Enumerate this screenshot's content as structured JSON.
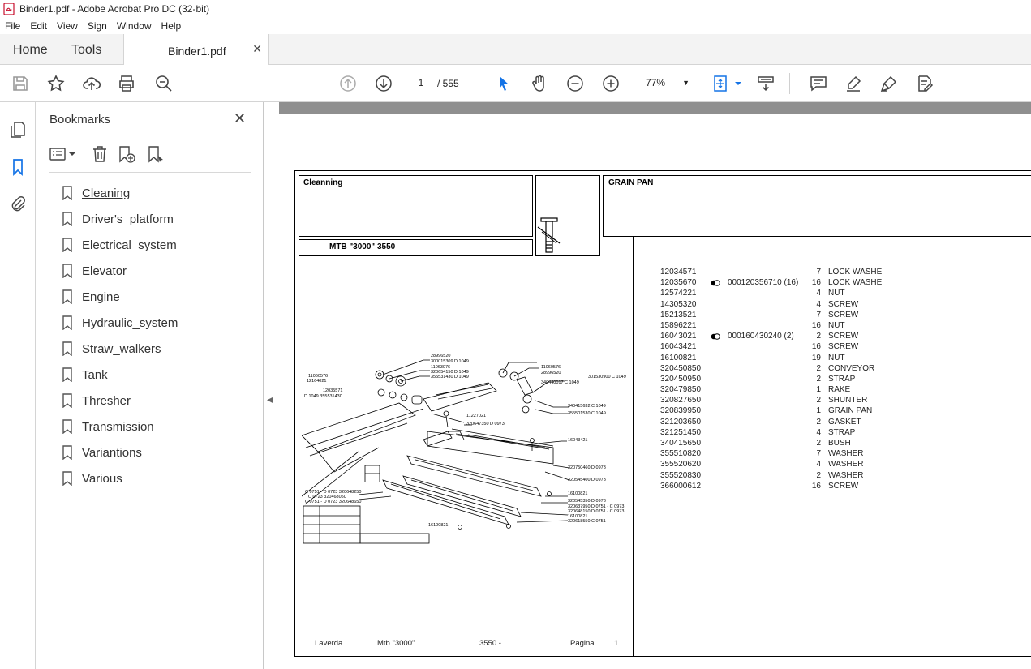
{
  "window": {
    "title": "Binder1.pdf - Adobe Acrobat Pro DC (32-bit)"
  },
  "menu": [
    "File",
    "Edit",
    "View",
    "Sign",
    "Window",
    "Help"
  ],
  "tabs": {
    "home": "Home",
    "tools": "Tools",
    "document": "Binder1.pdf"
  },
  "toolbar": {
    "page_current": "1",
    "page_total": "/ 555",
    "zoom": "77%"
  },
  "bookmarks": {
    "title": "Bookmarks",
    "items": [
      {
        "label": "Cleaning"
      },
      {
        "label": "Driver's_platform"
      },
      {
        "label": "Electrical_system"
      },
      {
        "label": "Elevator"
      },
      {
        "label": "Engine"
      },
      {
        "label": "Hydraulic_system"
      },
      {
        "label": "Straw_walkers"
      },
      {
        "label": "Tank"
      },
      {
        "label": "Thresher"
      },
      {
        "label": "Transmission"
      },
      {
        "label": "Variantions"
      },
      {
        "label": "Various"
      }
    ]
  },
  "document": {
    "group": "Cleanning",
    "model": "MTB \"3000\" 3550",
    "section": "GRAIN PAN",
    "parts": [
      {
        "code": "12034571",
        "alt": "",
        "qty": "7",
        "desc": "LOCK WASHE"
      },
      {
        "code": "12035670",
        "alt": "000120356710 (16)",
        "qty": "16",
        "desc": "LOCK WASHE"
      },
      {
        "code": "12574221",
        "alt": "",
        "qty": "4",
        "desc": "NUT"
      },
      {
        "code": "14305320",
        "alt": "",
        "qty": "4",
        "desc": "SCREW"
      },
      {
        "code": "15213521",
        "alt": "",
        "qty": "7",
        "desc": "SCREW"
      },
      {
        "code": "15896221",
        "alt": "",
        "qty": "16",
        "desc": "NUT"
      },
      {
        "code": "16043021",
        "alt": "000160430240 (2)",
        "qty": "2",
        "desc": "SCREW"
      },
      {
        "code": "16043421",
        "alt": "",
        "qty": "16",
        "desc": "SCREW"
      },
      {
        "code": "16100821",
        "alt": "",
        "qty": "19",
        "desc": "NUT"
      },
      {
        "code": "320450850",
        "alt": "",
        "qty": "2",
        "desc": "CONVEYOR"
      },
      {
        "code": "320450950",
        "alt": "",
        "qty": "2",
        "desc": "STRAP"
      },
      {
        "code": "320479850",
        "alt": "",
        "qty": "1",
        "desc": "RAKE"
      },
      {
        "code": "320827650",
        "alt": "",
        "qty": "2",
        "desc": "SHUNTER"
      },
      {
        "code": "320839950",
        "alt": "",
        "qty": "1",
        "desc": "GRAIN PAN"
      },
      {
        "code": "321203650",
        "alt": "",
        "qty": "2",
        "desc": "GASKET"
      },
      {
        "code": "321251450",
        "alt": "",
        "qty": "4",
        "desc": "STRAP"
      },
      {
        "code": "340415650",
        "alt": "",
        "qty": "2",
        "desc": "BUSH"
      },
      {
        "code": "355510820",
        "alt": "",
        "qty": "7",
        "desc": "WASHER"
      },
      {
        "code": "355520620",
        "alt": "",
        "qty": "4",
        "desc": "WASHER"
      },
      {
        "code": "355520830",
        "alt": "",
        "qty": "2",
        "desc": "WASHER"
      },
      {
        "code": "366000612",
        "alt": "",
        "qty": "16",
        "desc": "SCREW"
      }
    ],
    "diagram_labels": [
      "28996520",
      "300015309 D 1049",
      "11060576",
      "12164021",
      "11063076",
      "320654150 D 1049",
      "355531430 D 1049",
      "12035571",
      "D 1049 355531430",
      "11060576",
      "28996520",
      "301530900 C 1049",
      "340440017 C 1049",
      "340415632 C 1049",
      "355501530 C 1049",
      "11227021",
      "320647350 D 0973",
      "16043421",
      "320750460 D 0973",
      "320545400 D 0973",
      "16100821",
      "320545350 D 0973",
      "320637950 D 0751 - C 0973",
      "320648150 D 0751 - C 0973",
      "16100821",
      "320618550 C 0751",
      "16100821",
      "C 0751 - D 0723 320648250",
      "C 0723 320468050",
      "C 0751 - D 0723 320648650"
    ],
    "footer": {
      "brand": "Laverda",
      "model": "Mtb \"3000\"",
      "ref": "3550 - .",
      "page_label": "Pagina",
      "page_no": "1"
    }
  }
}
